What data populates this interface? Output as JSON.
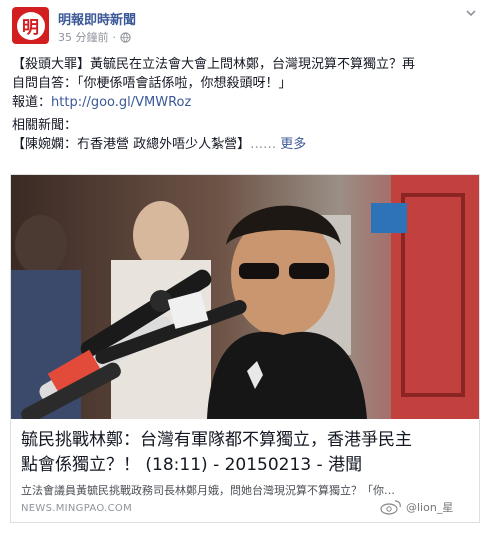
{
  "header": {
    "page_name": "明報即時新聞",
    "timestamp": "35 分鐘前",
    "separator": "·",
    "avatar_glyph": "明"
  },
  "post": {
    "line1": "【殺頭大罪】黃毓民在立法會大會上問林鄭，台灣現況算不算獨立？再",
    "line2": "自問自答：「你梗係唔會話係啦，你想殺頭呀！」",
    "link_label": "報道：",
    "link_url": "http://goo.gl/VMWRoz",
    "related_label": "相關新聞：",
    "related_text": "【陳婉嫻：冇香港營 政總外唔少人紮營】",
    "ellipsis": "……",
    "more_link": "更多"
  },
  "card": {
    "title_line1": "毓民挑戰林鄭：台灣有軍隊都不算獨立，香港爭民主",
    "title_line2": "點會係獨立？！ (18:11) - 20150213 - 港聞",
    "description": "立法會議員黃毓民挑戰政務司長林鄭月娥，問她台灣現況算不算獨立？「你…",
    "domain": "NEWS.MINGPAO.COM"
  },
  "watermark": {
    "text": "@lion_星"
  },
  "colors": {
    "link": "#3b5998",
    "brand_red": "#d21e1e",
    "meta_gray": "#90949c"
  }
}
